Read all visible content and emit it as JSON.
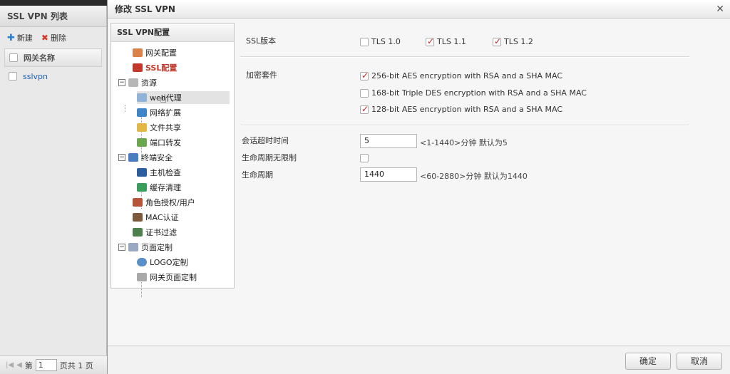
{
  "background_panel": {
    "title": "SSL VPN 列表",
    "new_label": "新建",
    "delete_label": "删除",
    "column_header": "网关名称",
    "rows": [
      "sslvpn"
    ],
    "pager": {
      "page_label": "第",
      "page_value": "1",
      "total_label": "页共 1 页"
    }
  },
  "dialog": {
    "title": "修改 SSL VPN",
    "tree": {
      "header": "SSL VPN配置",
      "items": [
        {
          "label": "网关配置",
          "icon": "gateway-config-icon"
        },
        {
          "label": "SSL配置",
          "icon": "ssl-config-icon"
        },
        {
          "label": "资源",
          "icon": "resource-icon"
        },
        {
          "label": "web代理",
          "icon": "web-proxy-icon"
        },
        {
          "label": "网络扩展",
          "icon": "network-extension-icon"
        },
        {
          "label": "文件共享",
          "icon": "file-share-icon"
        },
        {
          "label": "端口转发",
          "icon": "port-forward-icon"
        },
        {
          "label": "终端安全",
          "icon": "endpoint-security-icon"
        },
        {
          "label": "主机检查",
          "icon": "host-check-icon"
        },
        {
          "label": "缓存清理",
          "icon": "cache-clean-icon"
        },
        {
          "label": "角色授权/用户",
          "icon": "role-user-icon"
        },
        {
          "label": "MAC认证",
          "icon": "mac-auth-icon"
        },
        {
          "label": "证书过滤",
          "icon": "cert-filter-icon"
        },
        {
          "label": "页面定制",
          "icon": "page-custom-icon"
        },
        {
          "label": "LOGO定制",
          "icon": "logo-custom-icon"
        },
        {
          "label": "网关页面定制",
          "icon": "gateway-page-icon"
        }
      ]
    },
    "ssl_version": {
      "label": "SSL版本",
      "options": [
        {
          "label": "TLS 1.0",
          "checked": false
        },
        {
          "label": "TLS 1.1",
          "checked": true
        },
        {
          "label": "TLS 1.2",
          "checked": true
        }
      ]
    },
    "cipher_suites": {
      "label": "加密套件",
      "options": [
        {
          "label": "256-bit AES encryption with RSA and a SHA MAC",
          "checked": true
        },
        {
          "label": "168-bit Triple DES encryption with RSA and a SHA MAC",
          "checked": false
        },
        {
          "label": "128-bit AES encryption with RSA and a SHA MAC",
          "checked": true
        }
      ]
    },
    "session_timeout": {
      "label": "会话超时时间",
      "value": "5",
      "hint": "<1-1440>分钟 默认为5"
    },
    "unlimited_lifetime": {
      "label": "生命周期无限制",
      "checked": false
    },
    "lifetime": {
      "label": "生命周期",
      "value": "1440",
      "hint": "<60-2880>分钟 默认为1440"
    },
    "buttons": {
      "ok": "确定",
      "cancel": "取消"
    }
  }
}
